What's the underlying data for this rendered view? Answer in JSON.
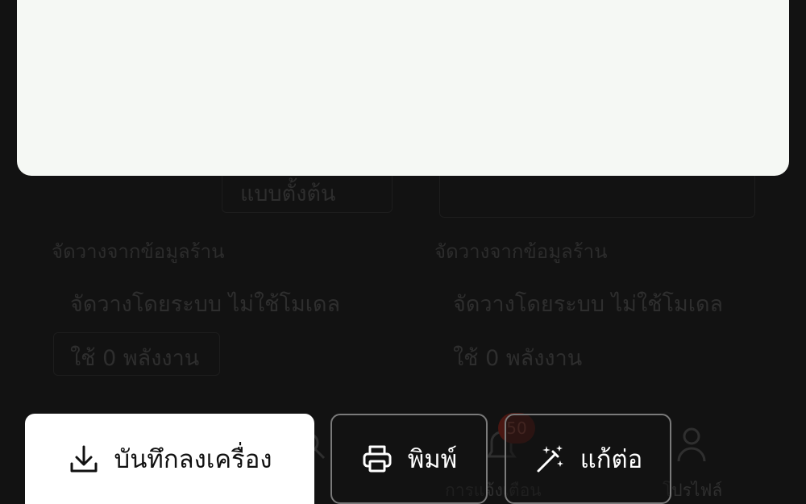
{
  "background": {
    "layout_style_label": "แบบตั้งต้น",
    "left_option": {
      "source_label": "จัดวางจากข้อมูลร้าน",
      "method_label": "จัดวางโดยระบบ ไม่ใช้โมเดล",
      "energy_label": "ใช้ 0 พลังงาน"
    },
    "right_option": {
      "source_label": "จัดวางจากข้อมูลร้าน",
      "method_label": "จัดวางโดยระบบ ไม่ใช้โมเดล",
      "energy_label": "ใช้ 0 พลังงาน"
    },
    "nav": {
      "notifications_label": "การแจ้งเตือน",
      "notifications_badge": "50",
      "profile_label": "โปรไฟล์"
    }
  },
  "actions": {
    "save_label": "บันทึกลงเครื่อง",
    "print_label": "พิมพ์",
    "edit_label": "แก้ต่อ"
  },
  "colors": {
    "overlay": "#121212",
    "card": "#f5f8f4",
    "primary_button": "#ffffff",
    "outline": "#7a7a7a"
  }
}
